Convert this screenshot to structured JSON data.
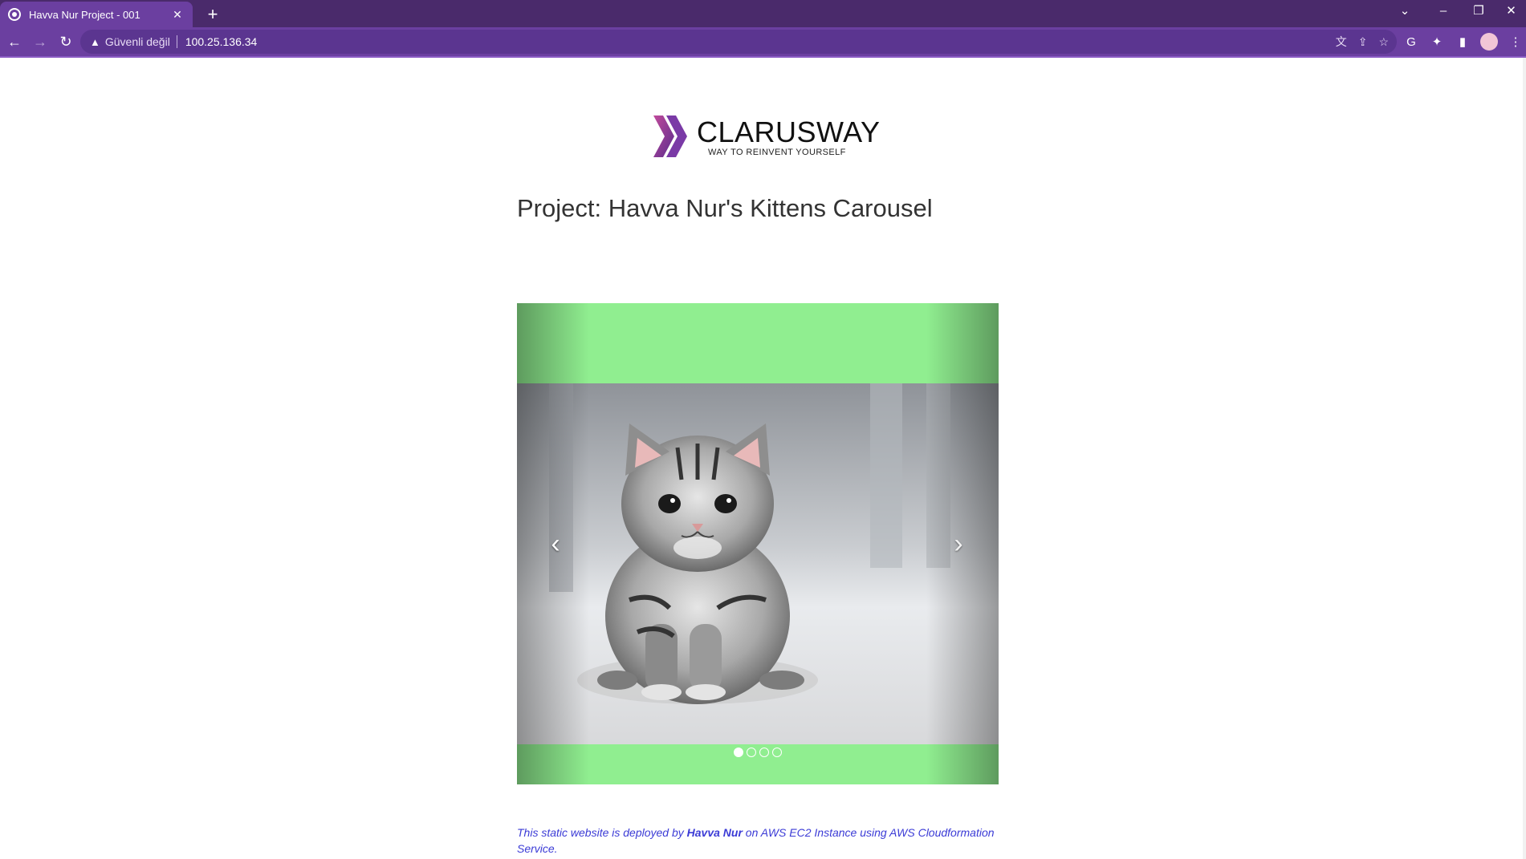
{
  "browser": {
    "tab_title": "Havva Nur Project - 001",
    "security_label": "Güvenli değil",
    "url": "100.25.136.34",
    "accent_color": "#6b3fa0",
    "icons": {
      "tab_close": "✕",
      "new_tab": "+",
      "tab_list": "⌄",
      "minimize": "–",
      "restore": "❐",
      "close_window": "✕",
      "back": "←",
      "forward": "→",
      "reload": "↻",
      "warning": "▲",
      "translate": "文",
      "share": "⇪",
      "bookmark": "☆",
      "extension_translate": "G",
      "extensions": "✦",
      "side_panel": "▮",
      "menu": "⋮"
    }
  },
  "page": {
    "logo": {
      "brand": "CLARUSWAY",
      "tagline": "WAY TO REINVENT YOURSELF"
    },
    "heading": "Project: Havva Nur's Kittens Carousel",
    "carousel": {
      "background_color": "#90ee90",
      "prev_label": "‹",
      "next_label": "›",
      "slides": 4,
      "active_slide": 1
    },
    "footer": {
      "before": "This static website is deployed by ",
      "author": "Havva Nur",
      "after": " on AWS EC2 Instance using AWS Cloudformation Service."
    }
  }
}
